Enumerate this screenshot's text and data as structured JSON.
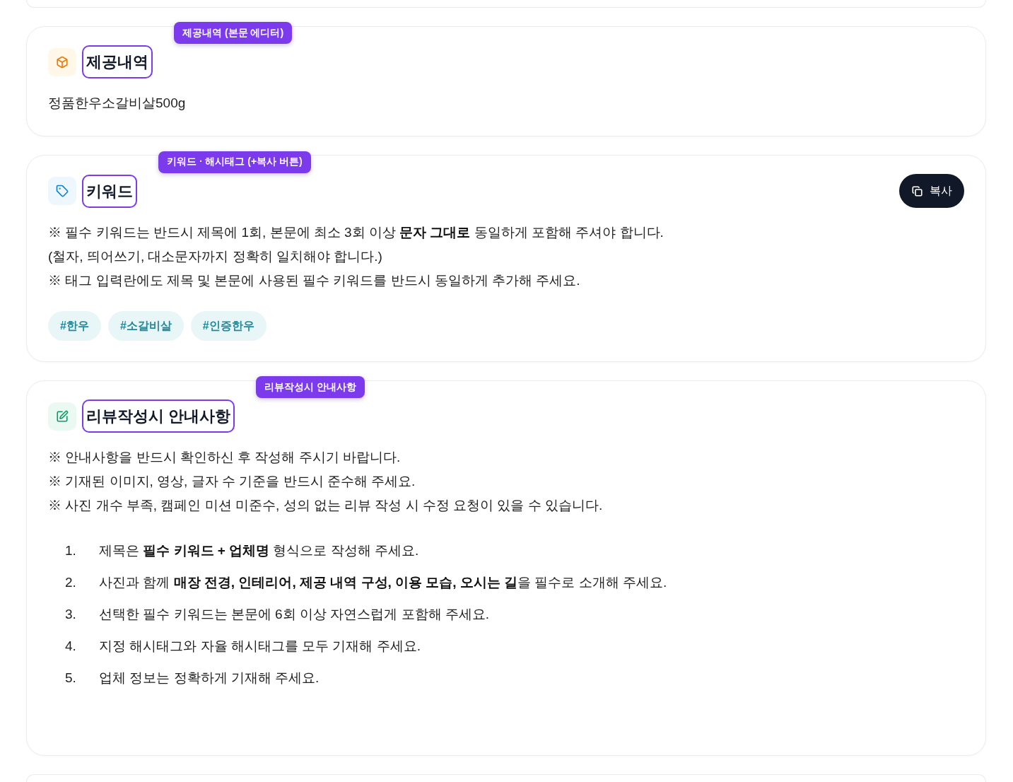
{
  "sections": [
    {
      "kind": "provided",
      "badge": "제공내역 (본문 에디터)",
      "title": "제공내역",
      "text": "정품한우소갈비살500g"
    },
    {
      "kind": "keywords",
      "badge": "키워드 · 해시태그 (+복사 버튼)",
      "title": "키워드",
      "copy_button": "복사",
      "notes": [
        "※ 필수 키워드는 반드시 제목에 1회, 본문에 최소 3회 이상 **문자 그대로** 동일하게 포함해 주셔야 합니다.",
        "(철자, 띄어쓰기, 대소문자까지 정확히 일치해야 합니다.)",
        "※ 태그 입력란에도 제목 및 본문에 사용된 필수 키워드를 반드시 동일하게 추가해 주세요."
      ],
      "tags": [
        "#한우",
        "#소갈비살",
        "#인증한우"
      ]
    },
    {
      "kind": "guide",
      "badge": "리뷰작성시 안내사항",
      "title": "리뷰작성시 안내사항",
      "notes": [
        "※ 안내사항을 반드시 확인하신 후 작성해 주시기 바랍니다.",
        "※ 기재된 이미지, 영상, 글자 수 기준을 반드시 준수해 주세요.",
        "※ 사진 개수 부족, 캠페인 미션 미준수, 성의 없는 리뷰 작성 시 수정 요청이 있을 수 있습니다."
      ],
      "steps": [
        {
          "number": "1.",
          "text": "제목은 **필수 키워드 + 업체명** 형식으로 작성해 주세요."
        },
        {
          "number": "2.",
          "text": "사진과 함께 **매장 전경, 인테리어, 제공 내역 구성, 이용 모습, 오시는 길**을 필수로 소개해 주세요."
        },
        {
          "number": "3.",
          "text": "선택한 필수 키워드는 본문에 6회 이상 자연스럽게 포함해 주세요."
        },
        {
          "number": "4.",
          "text": "지정 해시태그와 자율 해시태그를 모두 기재해 주세요."
        },
        {
          "number": "5.",
          "text": "업체 정보는 정확하게 기재해 주세요."
        }
      ]
    }
  ]
}
